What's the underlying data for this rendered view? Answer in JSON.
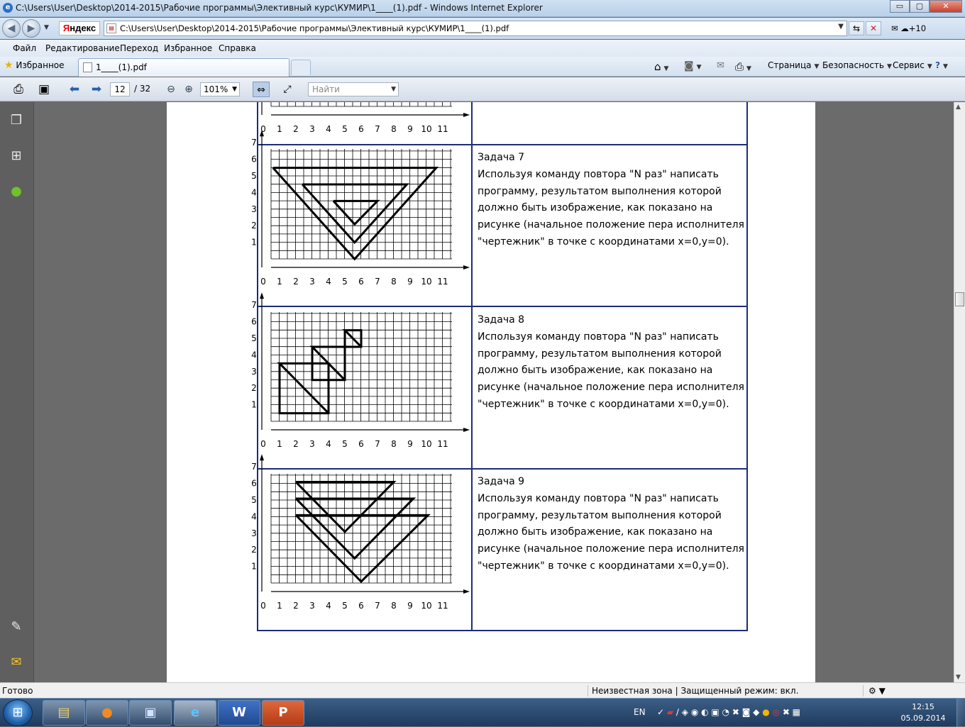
{
  "window": {
    "title": "C:\\Users\\User\\Desktop\\2014-2015\\Рабочие программы\\Элективный курс\\КУМИР\\1____(1).pdf - Windows Internet Explorer",
    "minimize": "▭",
    "maximize": "▢",
    "close": "✕"
  },
  "address": {
    "yandex_prefix": "Я",
    "yandex_rest": "ндекс",
    "url": "C:\\Users\\User\\Desktop\\2014-2015\\Рабочие программы\\Элективный курс\\КУМИР\\1____(1).pdf",
    "weather": "+10"
  },
  "menu": [
    "Файл",
    "Редактирование",
    "Переход",
    "Избранное",
    "Справка"
  ],
  "favorites": {
    "label": "Избранное",
    "tab_title": "1____(1).pdf"
  },
  "commands": {
    "page": "Страница",
    "safety": "Безопасность",
    "service": "Сервис"
  },
  "pdf_toolbar": {
    "current_page": "12",
    "total_pages": "/ 32",
    "zoom": "101%",
    "find_placeholder": "Найти"
  },
  "grid": {
    "x_ticks": [
      "0",
      "1",
      "2",
      "3",
      "4",
      "5",
      "6",
      "7",
      "8",
      "9",
      "10",
      "11"
    ],
    "y_ticks": [
      "1",
      "2",
      "3",
      "4",
      "5",
      "6",
      "7"
    ]
  },
  "tasks": [
    {
      "title": "Задача 7",
      "lines": [
        "Используя команду повтора \"N раз\" написать",
        "программу, результатом выполнения которой",
        "должно быть изображение, как показано на",
        "рисунке (начальное положение пера исполнителя",
        "\"чертежник\" в точке с координатами x=0,y=0)."
      ]
    },
    {
      "title": "Задача 8",
      "lines": [
        "Используя команду повтора \"N раз\" написать",
        "программу, результатом выполнения которой",
        "должно быть изображение, как показано на",
        "рисунке (начальное положение пера исполнителя",
        "\"чертежник\" в точке с координатами x=0,y=0)."
      ]
    },
    {
      "title": "Задача 9",
      "lines": [
        "Используя команду повтора \"N раз\" написать",
        "программу, результатом выполнения которой",
        "должно быть изображение, как показано на",
        "рисунке (начальное положение пера исполнителя",
        "\"чертежник\" в точке с координатами x=0,y=0)."
      ]
    }
  ],
  "status": {
    "ready": "Готово",
    "zone": "Неизвестная зона | Защищенный режим: вкл."
  },
  "taskbar": {
    "lang": "EN",
    "time": "12:15",
    "date": "05.09.2014",
    "apps": [
      "file-explorer",
      "firefox",
      "remote-desktop",
      "internet-explorer",
      "word",
      "powerpoint"
    ]
  }
}
